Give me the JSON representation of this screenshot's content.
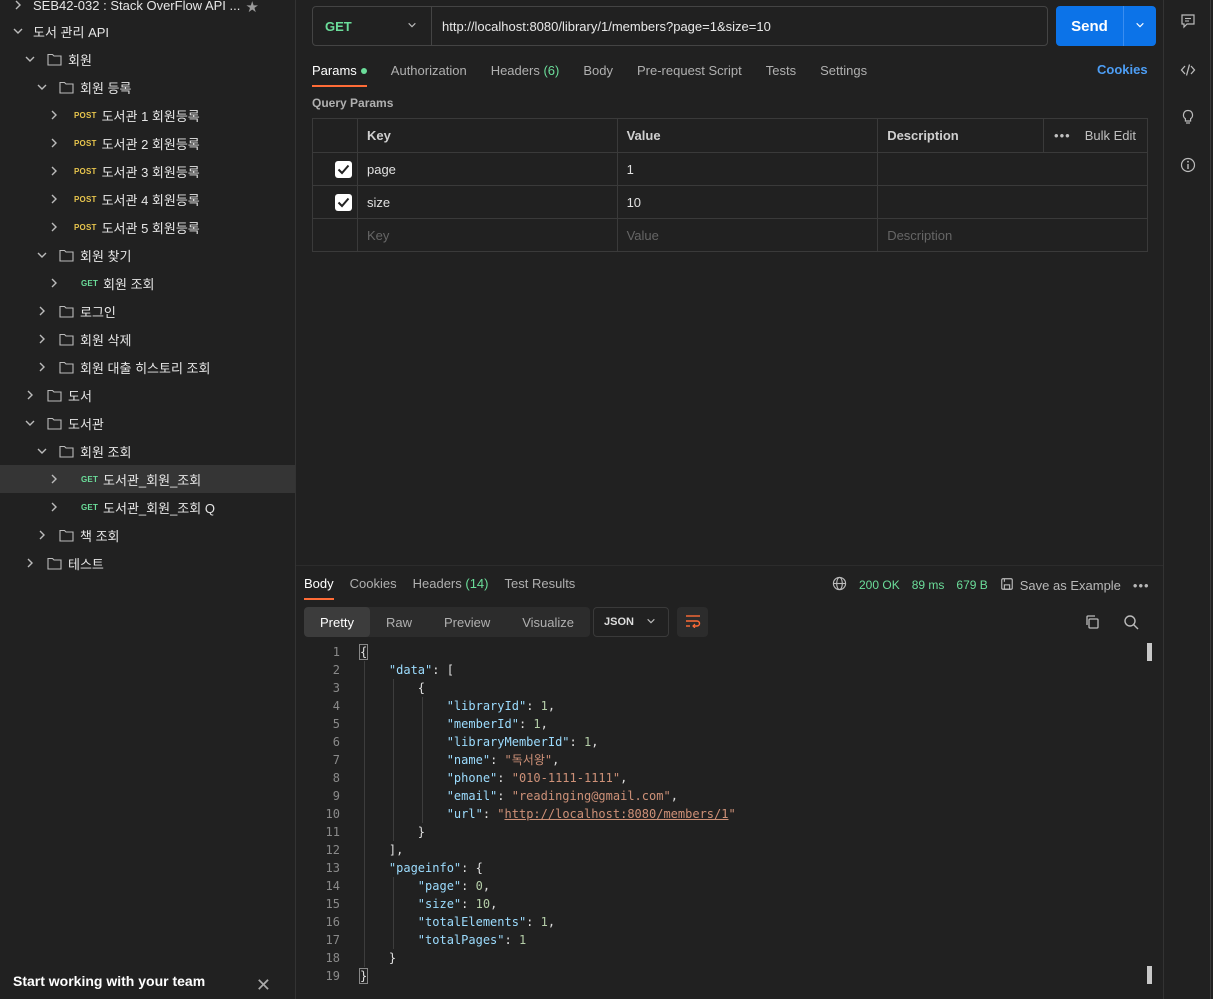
{
  "sidebar": {
    "workspace_title": "SEB42-032 : Stack OverFlow API ...",
    "collection_title": "도서 관리 API",
    "items": [
      {
        "label": "회원",
        "type": "folder"
      },
      {
        "label": "회원 등록",
        "type": "folder"
      },
      {
        "label": "도서관 1 회원등록",
        "method": "POST"
      },
      {
        "label": "도서관 2 회원등록",
        "method": "POST"
      },
      {
        "label": "도서관 3 회원등록",
        "method": "POST"
      },
      {
        "label": "도서관 4 회원등록",
        "method": "POST"
      },
      {
        "label": "도서관 5 회원등록",
        "method": "POST"
      },
      {
        "label": "회원 찾기",
        "type": "folder"
      },
      {
        "label": "회원 조회",
        "method": "GET"
      },
      {
        "label": "로그인",
        "type": "folder"
      },
      {
        "label": "회원 삭제",
        "type": "folder"
      },
      {
        "label": "회원 대출 히스토리 조회",
        "type": "folder"
      },
      {
        "label": "도서",
        "type": "folder"
      },
      {
        "label": "도서관",
        "type": "folder"
      },
      {
        "label": "회원 조회",
        "type": "folder"
      },
      {
        "label": "도서관_회원_조회",
        "method": "GET"
      },
      {
        "label": "도서관_회원_조회 Q",
        "method": "GET"
      },
      {
        "label": "책 조회",
        "type": "folder"
      },
      {
        "label": "테스트",
        "type": "folder"
      }
    ],
    "team_banner": "Start working with your team"
  },
  "request": {
    "method": "GET",
    "url": "http://localhost:8080/library/1/members?page=1&size=10",
    "send_label": "Send",
    "tabs": {
      "params": "Params",
      "authorization": "Authorization",
      "headers": "Headers",
      "headers_count": "(6)",
      "body": "Body",
      "prerequest": "Pre-request Script",
      "tests": "Tests",
      "settings": "Settings"
    },
    "cookies_label": "Cookies",
    "query_params_title": "Query Params",
    "table": {
      "headers": {
        "key": "Key",
        "value": "Value",
        "description": "Description",
        "bulk_edit": "Bulk Edit"
      },
      "rows": [
        {
          "key": "page",
          "value": "1",
          "description": "",
          "checked": true
        },
        {
          "key": "size",
          "value": "10",
          "description": "",
          "checked": true
        }
      ],
      "placeholders": {
        "key": "Key",
        "value": "Value",
        "description": "Description"
      }
    }
  },
  "response": {
    "tabs": {
      "body": "Body",
      "cookies": "Cookies",
      "headers": "Headers",
      "headers_count": "(14)",
      "test_results": "Test Results"
    },
    "status": "200 OK",
    "time": "89 ms",
    "size": "679 B",
    "save_example": "Save as Example",
    "view_tabs": {
      "pretty": "Pretty",
      "raw": "Raw",
      "preview": "Preview",
      "visualize": "Visualize"
    },
    "format": "JSON",
    "line_numbers": [
      "1",
      "2",
      "3",
      "4",
      "5",
      "6",
      "7",
      "8",
      "9",
      "10",
      "11",
      "12",
      "13",
      "14",
      "15",
      "16",
      "17",
      "18",
      "19"
    ],
    "json": {
      "data_key": "\"data\"",
      "library_id_key": "\"libraryId\"",
      "library_id": "1",
      "member_id_key": "\"memberId\"",
      "member_id": "1",
      "library_member_id_key": "\"libraryMemberId\"",
      "library_member_id": "1",
      "name_key": "\"name\"",
      "name": "\"독서왕\"",
      "phone_key": "\"phone\"",
      "phone": "\"010-1111-1111\"",
      "email_key": "\"email\"",
      "email": "\"readinging@gmail.com\"",
      "url_key": "\"url\"",
      "url": "http://localhost:8080/members/1",
      "pageinfo_key": "\"pageinfo\"",
      "page_key": "\"page\"",
      "page": "0",
      "size_key": "\"size\"",
      "size": "10",
      "total_elements_key": "\"totalElements\"",
      "total_elements": "1",
      "total_pages_key": "\"totalPages\"",
      "total_pages": "1"
    }
  },
  "colors": {
    "accent": "#ff6c37",
    "send_button": "#0c73e8",
    "method_get": "#6bdd9a",
    "method_post": "#e8c54d",
    "link": "#4d9ef5"
  },
  "rail_icons": [
    "comment-icon",
    "code-icon",
    "lightbulb-icon",
    "info-icon"
  ]
}
